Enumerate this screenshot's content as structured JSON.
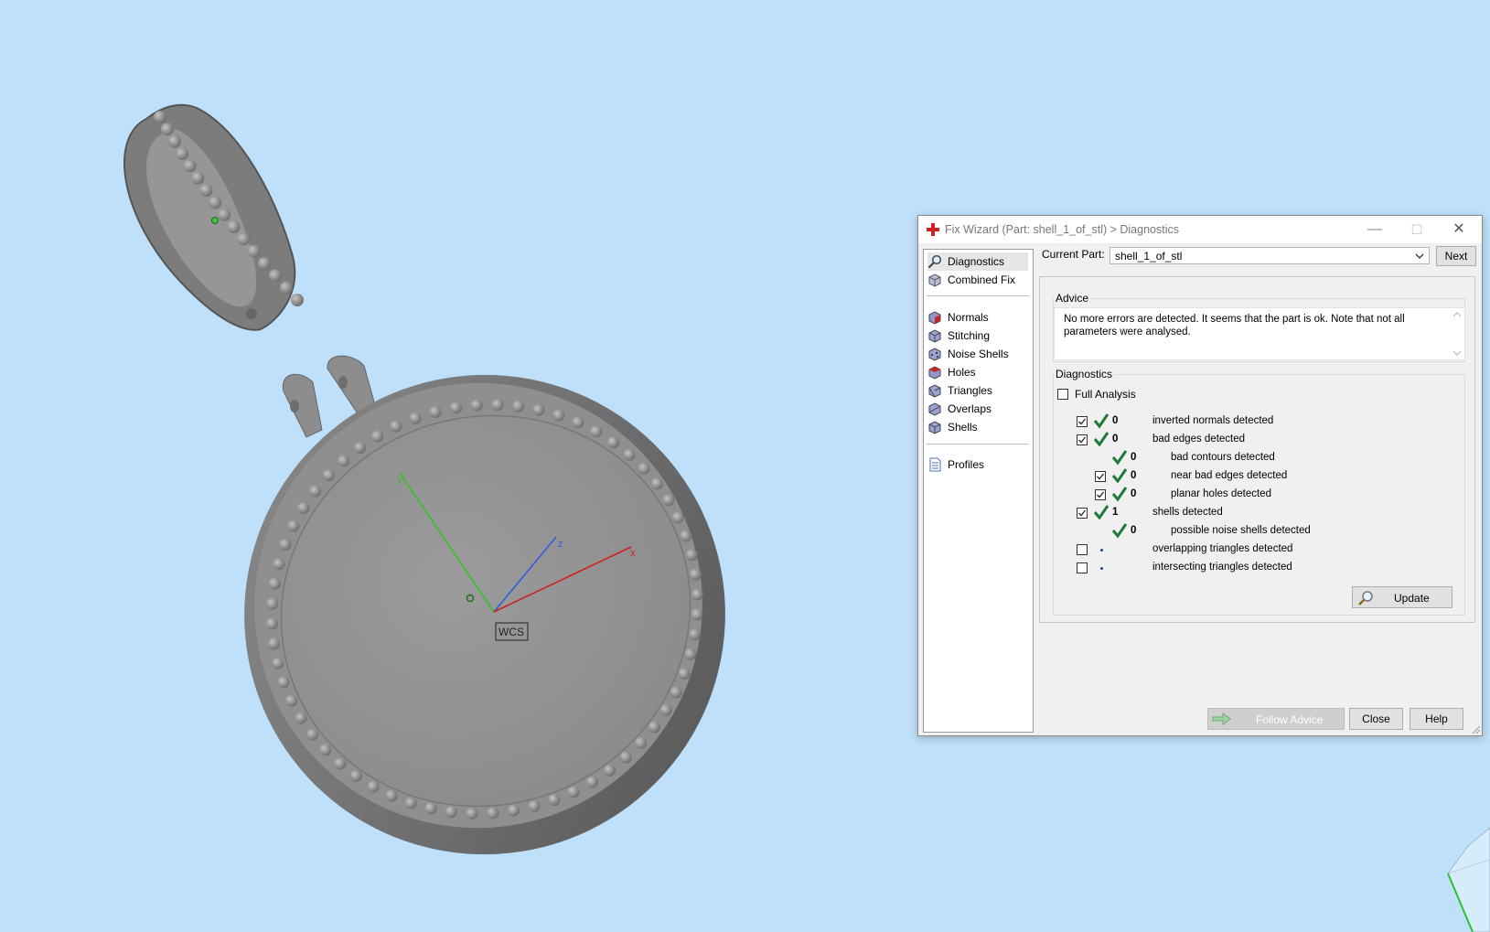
{
  "viewport": {
    "wcs_label": "WCS",
    "axes": {
      "x": "x",
      "y": "y",
      "z": "z"
    }
  },
  "dialog": {
    "title": "Fix Wizard (Part: shell_1_of_stl) > Diagnostics",
    "sidebar": {
      "items": [
        {
          "label": "Diagnostics",
          "icon": "magnifier-icon",
          "selected": true
        },
        {
          "label": "Combined Fix",
          "icon": "cube-icon"
        },
        {
          "label": "Normals",
          "icon": "normals-cube-icon"
        },
        {
          "label": "Stitching",
          "icon": "stitching-cube-icon"
        },
        {
          "label": "Noise Shells",
          "icon": "noise-shells-cube-icon"
        },
        {
          "label": "Holes",
          "icon": "holes-cube-icon"
        },
        {
          "label": "Triangles",
          "icon": "triangles-cube-icon"
        },
        {
          "label": "Overlaps",
          "icon": "overlaps-cube-icon"
        },
        {
          "label": "Shells",
          "icon": "shells-cube-icon"
        },
        {
          "label": "Profiles",
          "icon": "document-icon"
        }
      ]
    },
    "current_part_label": "Current Part:",
    "current_part_value": "shell_1_of_stl",
    "next_label": "Next",
    "advice": {
      "group_label": "Advice",
      "text": "No more errors are detected. It seems that the part is ok. Note that not all parameters were analysed."
    },
    "diagnostics": {
      "group_label": "Diagnostics",
      "full_analysis_label": "Full Analysis",
      "full_analysis_checked": false,
      "rows": [
        {
          "checkbox": true,
          "checked": true,
          "status": "ok",
          "count": "0",
          "text": "inverted normals detected"
        },
        {
          "checkbox": true,
          "checked": true,
          "status": "ok",
          "count": "0",
          "text": "bad edges detected"
        },
        {
          "checkbox": false,
          "checked": false,
          "status": "ok",
          "count": "0",
          "text": "bad contours detected"
        },
        {
          "checkbox": true,
          "checked": true,
          "status": "ok",
          "count": "0",
          "text": "near bad edges detected"
        },
        {
          "checkbox": true,
          "checked": true,
          "status": "ok",
          "count": "0",
          "text": "planar holes detected"
        },
        {
          "checkbox": true,
          "checked": true,
          "status": "ok",
          "count": "1",
          "text": "shells detected"
        },
        {
          "checkbox": false,
          "checked": false,
          "status": "ok",
          "count": "0",
          "text": "possible noise shells detected"
        },
        {
          "checkbox": true,
          "checked": false,
          "status": "none",
          "count": "",
          "text": "overlapping triangles detected"
        },
        {
          "checkbox": true,
          "checked": false,
          "status": "none",
          "count": "",
          "text": "intersecting triangles detected"
        }
      ],
      "update_label": "Update"
    },
    "buttons": {
      "follow_advice": "Follow Advice",
      "close": "Close",
      "help": "Help"
    }
  },
  "colors": {
    "background": "#bfe0fa",
    "check_green": "#1f7a3a",
    "axis_x": "#d22020",
    "axis_y": "#3bbf2a",
    "axis_z": "#2f5fe0"
  }
}
